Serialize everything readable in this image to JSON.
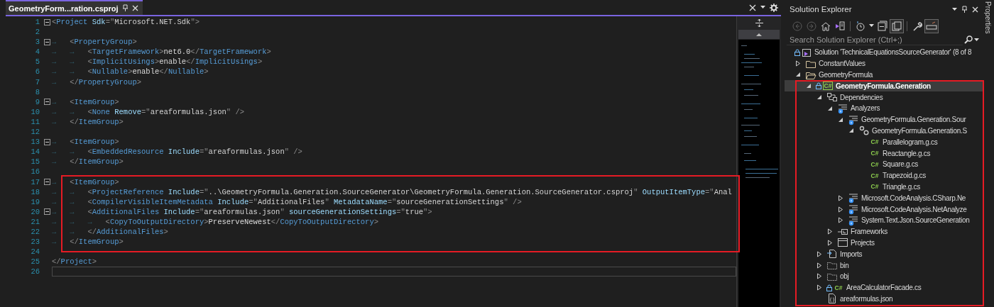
{
  "editor": {
    "tab": {
      "title": "GeometryForm...ration.csproj",
      "selected": true
    },
    "blocks": [
      {
        "kind": "plain",
        "lines": [
          {
            "n": "1",
            "fold": true,
            "tokens": [
              {
                "kind": "d",
                "text": "<"
              },
              {
                "kind": "tag",
                "text": "Project"
              },
              {
                "kind": "attr",
                "text": " Sdk"
              },
              {
                "kind": "d",
                "text": "=\""
              },
              {
                "kind": "str",
                "text": "Microsoft.NET.Sdk"
              },
              {
                "kind": "d",
                "text": "\">"
              }
            ]
          },
          {
            "n": "2"
          },
          {
            "n": "3",
            "fold": true,
            "tokens": [
              {
                "kind": "ws",
                "text": "→"
              },
              {
                "kind": "d",
                "text": "<"
              },
              {
                "kind": "tag",
                "text": "PropertyGroup"
              },
              {
                "kind": "d",
                "text": ">"
              }
            ]
          },
          {
            "n": "4",
            "tokens": [
              {
                "kind": "ws",
                "text": "→"
              },
              {
                "kind": "ws",
                "text": "→"
              },
              {
                "kind": "d",
                "text": "<"
              },
              {
                "kind": "tag",
                "text": "TargetFramework"
              },
              {
                "kind": "d",
                "text": ">"
              },
              {
                "kind": "text",
                "text": "net6.0"
              },
              {
                "kind": "d",
                "text": "</"
              },
              {
                "kind": "tag",
                "text": "TargetFramework"
              },
              {
                "kind": "d",
                "text": ">"
              }
            ]
          },
          {
            "n": "5",
            "tokens": [
              {
                "kind": "ws",
                "text": "→"
              },
              {
                "kind": "ws",
                "text": "→"
              },
              {
                "kind": "d",
                "text": "<"
              },
              {
                "kind": "tag",
                "text": "ImplicitUsings"
              },
              {
                "kind": "d",
                "text": ">"
              },
              {
                "kind": "text",
                "text": "enable"
              },
              {
                "kind": "d",
                "text": "</"
              },
              {
                "kind": "tag",
                "text": "ImplicitUsings"
              },
              {
                "kind": "d",
                "text": ">"
              }
            ]
          },
          {
            "n": "6",
            "tokens": [
              {
                "kind": "ws",
                "text": "→"
              },
              {
                "kind": "ws",
                "text": "→"
              },
              {
                "kind": "d",
                "text": "<"
              },
              {
                "kind": "tag",
                "text": "Nullable"
              },
              {
                "kind": "d",
                "text": ">"
              },
              {
                "kind": "text",
                "text": "enable"
              },
              {
                "kind": "d",
                "text": "</"
              },
              {
                "kind": "tag",
                "text": "Nullable"
              },
              {
                "kind": "d",
                "text": ">"
              }
            ]
          },
          {
            "n": "7",
            "tokens": [
              {
                "kind": "ws",
                "text": "→"
              },
              {
                "kind": "d",
                "text": "</"
              },
              {
                "kind": "tag",
                "text": "PropertyGroup"
              },
              {
                "kind": "d",
                "text": ">"
              }
            ]
          },
          {
            "n": "8"
          },
          {
            "n": "9",
            "fold": true,
            "tokens": [
              {
                "kind": "ws",
                "text": "→"
              },
              {
                "kind": "d",
                "text": "<"
              },
              {
                "kind": "tag",
                "text": "ItemGroup"
              },
              {
                "kind": "d",
                "text": ">"
              }
            ]
          },
          {
            "n": "10",
            "tokens": [
              {
                "kind": "ws",
                "text": "→"
              },
              {
                "kind": "ws",
                "text": "→"
              },
              {
                "kind": "d",
                "text": "<"
              },
              {
                "kind": "tag",
                "text": "None"
              },
              {
                "kind": "attr",
                "text": " Remove"
              },
              {
                "kind": "d",
                "text": "=\""
              },
              {
                "kind": "str",
                "text": "areaformulas.json"
              },
              {
                "kind": "d",
                "text": "\" />"
              }
            ]
          },
          {
            "n": "11",
            "tokens": [
              {
                "kind": "ws",
                "text": "→"
              },
              {
                "kind": "d",
                "text": "</"
              },
              {
                "kind": "tag",
                "text": "ItemGroup"
              },
              {
                "kind": "d",
                "text": ">"
              }
            ]
          },
          {
            "n": "12"
          },
          {
            "n": "13",
            "fold": true,
            "tokens": [
              {
                "kind": "ws",
                "text": "→"
              },
              {
                "kind": "d",
                "text": "<"
              },
              {
                "kind": "tag",
                "text": "ItemGroup"
              },
              {
                "kind": "d",
                "text": ">"
              }
            ]
          },
          {
            "n": "14",
            "tokens": [
              {
                "kind": "ws",
                "text": "→"
              },
              {
                "kind": "ws",
                "text": "→"
              },
              {
                "kind": "d",
                "text": "<"
              },
              {
                "kind": "tag",
                "text": "EmbeddedResource"
              },
              {
                "kind": "attr",
                "text": " Include"
              },
              {
                "kind": "d",
                "text": "=\""
              },
              {
                "kind": "str",
                "text": "areaformulas.json"
              },
              {
                "kind": "d",
                "text": "\" />"
              }
            ]
          },
          {
            "n": "15",
            "tokens": [
              {
                "kind": "ws",
                "text": "→"
              },
              {
                "kind": "d",
                "text": "</"
              },
              {
                "kind": "tag",
                "text": "ItemGroup"
              },
              {
                "kind": "d",
                "text": ">"
              }
            ]
          },
          {
            "n": "16"
          }
        ]
      },
      {
        "kind": "highlighted",
        "lines": [
          {
            "n": "17",
            "fold": true,
            "tokens": [
              {
                "kind": "ws",
                "text": "→"
              },
              {
                "kind": "d",
                "text": "<"
              },
              {
                "kind": "tag",
                "text": "ItemGroup"
              },
              {
                "kind": "d",
                "text": ">"
              }
            ]
          },
          {
            "n": "18",
            "tokens": [
              {
                "kind": "ws",
                "text": "→"
              },
              {
                "kind": "ws",
                "text": "→"
              },
              {
                "kind": "d",
                "text": "<"
              },
              {
                "kind": "tag",
                "text": "ProjectReference"
              },
              {
                "kind": "attr",
                "text": " Include"
              },
              {
                "kind": "d",
                "text": "=\""
              },
              {
                "kind": "str",
                "text": "..\\GeometryFormula.Generation.SourceGenerator\\GeometryFormula.Generation.SourceGenerator.csproj"
              },
              {
                "kind": "d",
                "text": "\""
              },
              {
                "kind": "attr",
                "text": " OutputItemType"
              },
              {
                "kind": "d",
                "text": "=\""
              },
              {
                "kind": "str",
                "text": "Anal"
              }
            ]
          },
          {
            "n": "19",
            "tokens": [
              {
                "kind": "ws",
                "text": "→"
              },
              {
                "kind": "ws",
                "text": "→"
              },
              {
                "kind": "d",
                "text": "<"
              },
              {
                "kind": "tag",
                "text": "CompilerVisibleItemMetadata"
              },
              {
                "kind": "attr",
                "text": " Include"
              },
              {
                "kind": "d",
                "text": "=\""
              },
              {
                "kind": "str",
                "text": "AdditionalFiles"
              },
              {
                "kind": "d",
                "text": "\""
              },
              {
                "kind": "attr",
                "text": " MetadataName"
              },
              {
                "kind": "d",
                "text": "=\""
              },
              {
                "kind": "str",
                "text": "sourceGenerationSettings"
              },
              {
                "kind": "d",
                "text": "\" />"
              }
            ]
          },
          {
            "n": "20",
            "fold": true,
            "tokens": [
              {
                "kind": "ws",
                "text": "→"
              },
              {
                "kind": "ws",
                "text": "→"
              },
              {
                "kind": "d",
                "text": "<"
              },
              {
                "kind": "tag",
                "text": "AdditionalFiles"
              },
              {
                "kind": "attr",
                "text": " Include"
              },
              {
                "kind": "d",
                "text": "=\""
              },
              {
                "kind": "str",
                "text": "areaformulas.json"
              },
              {
                "kind": "d",
                "text": "\""
              },
              {
                "kind": "attr",
                "text": " sourceGenerationSettings"
              },
              {
                "kind": "d",
                "text": "=\""
              },
              {
                "kind": "str",
                "text": "true"
              },
              {
                "kind": "d",
                "text": "\">"
              }
            ]
          },
          {
            "n": "21",
            "tokens": [
              {
                "kind": "ws",
                "text": "→"
              },
              {
                "kind": "ws",
                "text": "→"
              },
              {
                "kind": "ws",
                "text": "→"
              },
              {
                "kind": "d",
                "text": "<"
              },
              {
                "kind": "tag",
                "text": "CopyToOutputDirectory"
              },
              {
                "kind": "d",
                "text": ">"
              },
              {
                "kind": "text",
                "text": "PreserveNewest"
              },
              {
                "kind": "d",
                "text": "</"
              },
              {
                "kind": "tag",
                "text": "CopyToOutputDirectory"
              },
              {
                "kind": "d",
                "text": ">"
              }
            ]
          },
          {
            "n": "22",
            "tokens": [
              {
                "kind": "ws",
                "text": "→"
              },
              {
                "kind": "ws",
                "text": "→"
              },
              {
                "kind": "d",
                "text": "</"
              },
              {
                "kind": "tag",
                "text": "AdditionalFiles"
              },
              {
                "kind": "d",
                "text": ">"
              }
            ]
          },
          {
            "n": "23",
            "tokens": [
              {
                "kind": "ws",
                "text": "→"
              },
              {
                "kind": "d",
                "text": "</"
              },
              {
                "kind": "tag",
                "text": "ItemGroup"
              },
              {
                "kind": "d",
                "text": ">"
              }
            ]
          },
          {
            "n": "24"
          }
        ]
      },
      {
        "kind": "plain",
        "lines": [
          {
            "n": "25",
            "tokens": [
              {
                "kind": "d",
                "text": "</"
              },
              {
                "kind": "tag",
                "text": "Project"
              },
              {
                "kind": "d",
                "text": ">"
              }
            ]
          },
          {
            "n": "26",
            "current": true
          }
        ]
      }
    ]
  },
  "solution_explorer": {
    "title": "Solution Explorer",
    "toolbar": [
      {
        "kind": "back",
        "disabled": true,
        "pressed": false
      },
      {
        "kind": "forward",
        "disabled": true,
        "pressed": false
      },
      {
        "kind": "home",
        "disabled": false,
        "pressed": false
      },
      {
        "kind": "switch_views",
        "disabled": false,
        "pressed": false
      },
      {
        "kind": "history",
        "disabled": false,
        "pressed": false
      },
      {
        "kind": "collapse_all",
        "disabled": false,
        "pressed": false
      },
      {
        "kind": "show_all_files",
        "disabled": false,
        "pressed": true
      },
      {
        "kind": "properties",
        "disabled": false,
        "pressed": false
      },
      {
        "kind": "preview",
        "disabled": false,
        "pressed": true
      }
    ],
    "search": {
      "placeholder": "Search Solution Explorer (Ctrl+;)"
    },
    "tree": [
      {
        "label": "Solution 'TechnicalEquationsSourceGenerator' (8 of 8",
        "kind": "solution",
        "locked": true,
        "selected": false,
        "children": [
          {
            "label": "ConstantValues",
            "kind": "folder",
            "expanded": false,
            "locked": false,
            "selected": false
          },
          {
            "label": "GeometryFormula",
            "kind": "folder",
            "expanded": true,
            "locked": false,
            "selected": false,
            "children": [
              {
                "label": "GeometryFormula.Generation",
                "kind": "project",
                "badge": "C#",
                "expanded": true,
                "locked": true,
                "selected": true,
                "boxed": true,
                "children": [
                  {
                    "label": "Dependencies",
                    "kind": "dependencies",
                    "expanded": true,
                    "locked": false,
                    "selected": false,
                    "children": [
                      {
                        "label": "Analyzers",
                        "kind": "analyzers",
                        "expanded": true,
                        "locked": false,
                        "selected": false,
                        "children": [
                          {
                            "label": "GeometryFormula.Generation.Sour",
                            "kind": "analyzer",
                            "expanded": true,
                            "locked": false,
                            "selected": false,
                            "children": [
                              {
                                "label": "GeometryFormula.Generation.S",
                                "kind": "generator",
                                "expanded": true,
                                "locked": false,
                                "selected": false,
                                "children": [
                                  {
                                    "label": "Parallelogram.g.cs",
                                    "kind": "cs_file",
                                    "badge": "C#",
                                    "locked": false,
                                    "selected": false
                                  },
                                  {
                                    "label": "Reactangle.g.cs",
                                    "kind": "cs_file",
                                    "badge": "C#",
                                    "locked": false,
                                    "selected": false
                                  },
                                  {
                                    "label": "Square.g.cs",
                                    "kind": "cs_file",
                                    "badge": "C#",
                                    "locked": false,
                                    "selected": false
                                  },
                                  {
                                    "label": "Trapezoid.g.cs",
                                    "kind": "cs_file",
                                    "badge": "C#",
                                    "locked": false,
                                    "selected": false
                                  },
                                  {
                                    "label": "Triangle.g.cs",
                                    "kind": "cs_file",
                                    "badge": "C#",
                                    "locked": false,
                                    "selected": false
                                  }
                                ]
                              }
                            ]
                          },
                          {
                            "label": "Microsoft.CodeAnalysis.CSharp.Ne",
                            "kind": "analyzer",
                            "expanded": false,
                            "locked": false,
                            "selected": false
                          },
                          {
                            "label": "Microsoft.CodeAnalysis.NetAnalyze",
                            "kind": "analyzer",
                            "expanded": false,
                            "locked": false,
                            "selected": false
                          },
                          {
                            "label": "System.Text.Json.SourceGeneration",
                            "kind": "analyzer",
                            "expanded": false,
                            "locked": false,
                            "selected": false
                          }
                        ]
                      },
                      {
                        "label": "Frameworks",
                        "kind": "frameworks",
                        "expanded": false,
                        "locked": false,
                        "selected": false
                      },
                      {
                        "label": "Projects",
                        "kind": "projects",
                        "expanded": false,
                        "locked": false,
                        "selected": false
                      }
                    ]
                  },
                  {
                    "label": "Imports",
                    "kind": "imports",
                    "expanded": false,
                    "locked": false,
                    "selected": false
                  },
                  {
                    "label": "bin",
                    "kind": "output_folder",
                    "expanded": false,
                    "locked": false,
                    "selected": false
                  },
                  {
                    "label": "obj",
                    "kind": "output_folder",
                    "expanded": false,
                    "locked": false,
                    "selected": false
                  },
                  {
                    "label": "AreaCalculatorFacade.cs",
                    "kind": "cs_file",
                    "badge": "C#",
                    "expanded": false,
                    "locked": true,
                    "selected": false
                  },
                  {
                    "label": "areaformulas.json",
                    "kind": "json_file",
                    "locked": false,
                    "selected": false
                  }
                ]
              }
            ]
          }
        ]
      }
    ]
  },
  "side_tab": {
    "label": "Properties"
  }
}
